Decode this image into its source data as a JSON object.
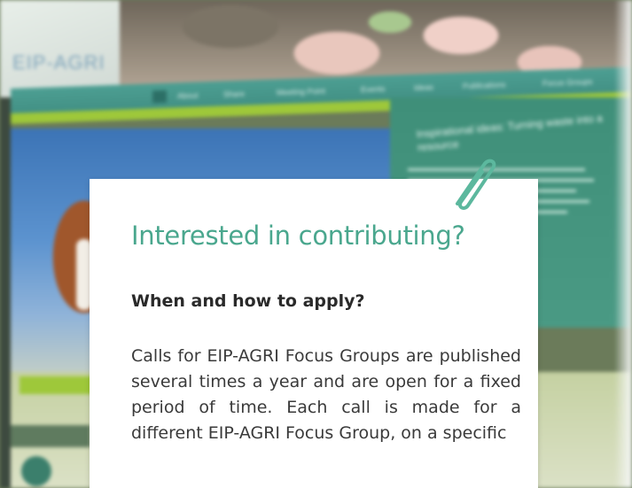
{
  "background": {
    "logo_text": "EIP-AGRI",
    "nav_items": [
      "About",
      "Share",
      "Meeting Point",
      "Events",
      "Ideas",
      "Publications",
      "Focus Groups"
    ],
    "panel_heading": "Inspirational ideas: Turning waste into a resource"
  },
  "card": {
    "title": "Interested in contributing?",
    "subtitle": "When and how to apply?",
    "body": "Calls for EIP-AGRI Focus Groups are published several times a year and are open for a fixed period of time. Each call is made for a different EIP-AGRI Focus Group, on a specific"
  },
  "colors": {
    "title": "#4aa78e",
    "paperclip": "#5cb89e",
    "nav_teal": "#4d9f93",
    "accent_green": "#9ec83a"
  },
  "icons": {
    "paperclip": "paperclip-icon",
    "home": "home-icon",
    "share": "share-icon"
  }
}
